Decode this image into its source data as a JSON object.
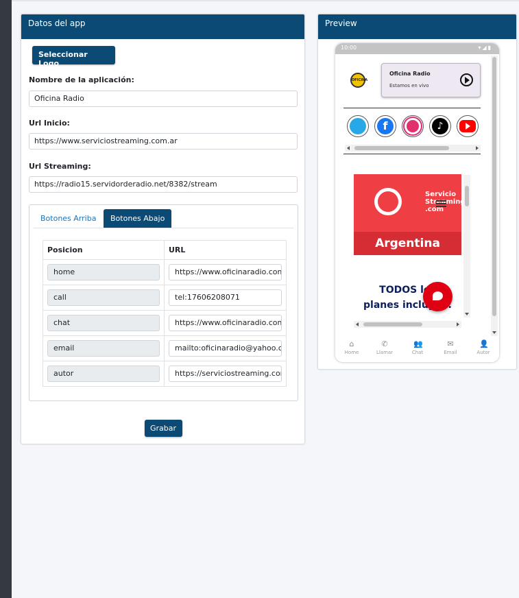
{
  "left_card": {
    "title": "Datos del app",
    "logo_button": "Seleccionar Logo",
    "fields": {
      "app_name_label": "Nombre de la aplicación:",
      "app_name_value": "Oficina Radio",
      "url_inicio_label": "Url Inicio:",
      "url_inicio_value": "https://www.serviciostreaming.com.ar",
      "url_streaming_label": "Url Streaming:",
      "url_streaming_value": "https://radio15.servidorderadio.net/8382/stream"
    },
    "tabs": [
      "Botones Arriba",
      "Botones Abajo"
    ],
    "table": {
      "headers": [
        "Posicion",
        "URL"
      ],
      "rows": [
        {
          "pos": "home",
          "url": "https://www.oficinaradio.com"
        },
        {
          "pos": "call",
          "url": "tel:17606208071"
        },
        {
          "pos": "chat",
          "url": "https://www.oficinaradio.com"
        },
        {
          "pos": "email",
          "url": "mailto:oficinaradio@yahoo.com"
        },
        {
          "pos": "autor",
          "url": "https://serviciostreaming.com.ar"
        }
      ]
    },
    "save_button": "Grabar"
  },
  "right_card": {
    "title": "Preview",
    "phone": {
      "time": "10:00",
      "status_icons": "▾◢▮",
      "logo_text": "OFICINA",
      "player_title": "Oficina Radio",
      "player_subtitle": "Estamos en vivo",
      "facebook_glyph": "f",
      "tiktok_glyph": "♪",
      "banner_brand_line1": "Servicio",
      "banner_brand_line2": "Streaming",
      "banner_brand_line3": ".com",
      "banner_country": "Argentina",
      "promo_line1": "TODOS los",
      "promo_line2": "planes incluyen:",
      "nav": [
        {
          "label": "Home",
          "icon": "⌂"
        },
        {
          "label": "Llamar",
          "icon": "✆"
        },
        {
          "label": "Chat",
          "icon": "👥"
        },
        {
          "label": "Email",
          "icon": "✉"
        },
        {
          "label": "Autor",
          "icon": "👤"
        }
      ]
    }
  },
  "colors": {
    "header_bg": "#0b4a74",
    "primary_button": "#0b4a74",
    "fab": "#e00013",
    "banner": "#ef3f44"
  }
}
